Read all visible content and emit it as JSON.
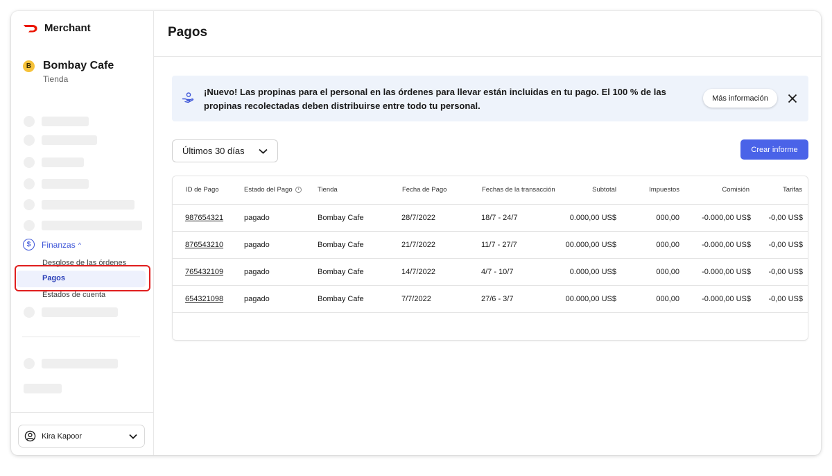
{
  "brand": {
    "name": "Merchant",
    "color": "#eb1700"
  },
  "store": {
    "initial": "B",
    "name": "Bombay Cafe",
    "subtitle": "Tienda"
  },
  "nav": {
    "finanzas_label": "Finanzas",
    "finanzas_icon": "dollar-circle-icon",
    "sub_items": [
      "Desglose de las órdenes",
      "Pagos",
      "Estados de cuenta"
    ],
    "active_item": "Pagos"
  },
  "user": {
    "name": "Kira Kapoor"
  },
  "page": {
    "title": "Pagos"
  },
  "banner": {
    "text": "¡Nuevo! Las propinas para el personal en las órdenes para llevar están incluidas en tu pago. El 100 % de las propinas recolectadas deben distribuirse entre todo tu personal.",
    "button_label": "Más información",
    "background": "#eef3fb"
  },
  "filters": {
    "date_range": "Últimos 30 días"
  },
  "actions": {
    "create_report": "Crear informe",
    "accent": "#4a63e8"
  },
  "table": {
    "headers": [
      "ID de Pago",
      "Estado del Pago",
      "Tienda",
      "Fecha de Pago",
      "Fechas de la transacción",
      "Subtotal",
      "Impuestos",
      "Comisión",
      "Tarifas"
    ],
    "rows": [
      [
        "987654321",
        "pagado",
        "Bombay Cafe",
        "28/7/2022",
        "18/7 - 24/7",
        "0.000,00 US$",
        "000,00",
        "-0.000,00 US$",
        "-0,00 US$"
      ],
      [
        "876543210",
        "pagado",
        "Bombay Cafe",
        "21/7/2022",
        "11/7 - 27/7",
        "00.000,00 US$",
        "000,00",
        "-0.000,00 US$",
        "-0,00 US$"
      ],
      [
        "765432109",
        "pagado",
        "Bombay Cafe",
        "14/7/2022",
        "4/7 - 10/7",
        "0.000,00 US$",
        "000,00",
        "-0.000,00 US$",
        "-0,00 US$"
      ],
      [
        "654321098",
        "pagado",
        "Bombay Cafe",
        "7/7/2022",
        "27/6 - 3/7",
        "00.000,00 US$",
        "000,00",
        "-0.000,00 US$",
        "-0,00 US$"
      ]
    ]
  }
}
